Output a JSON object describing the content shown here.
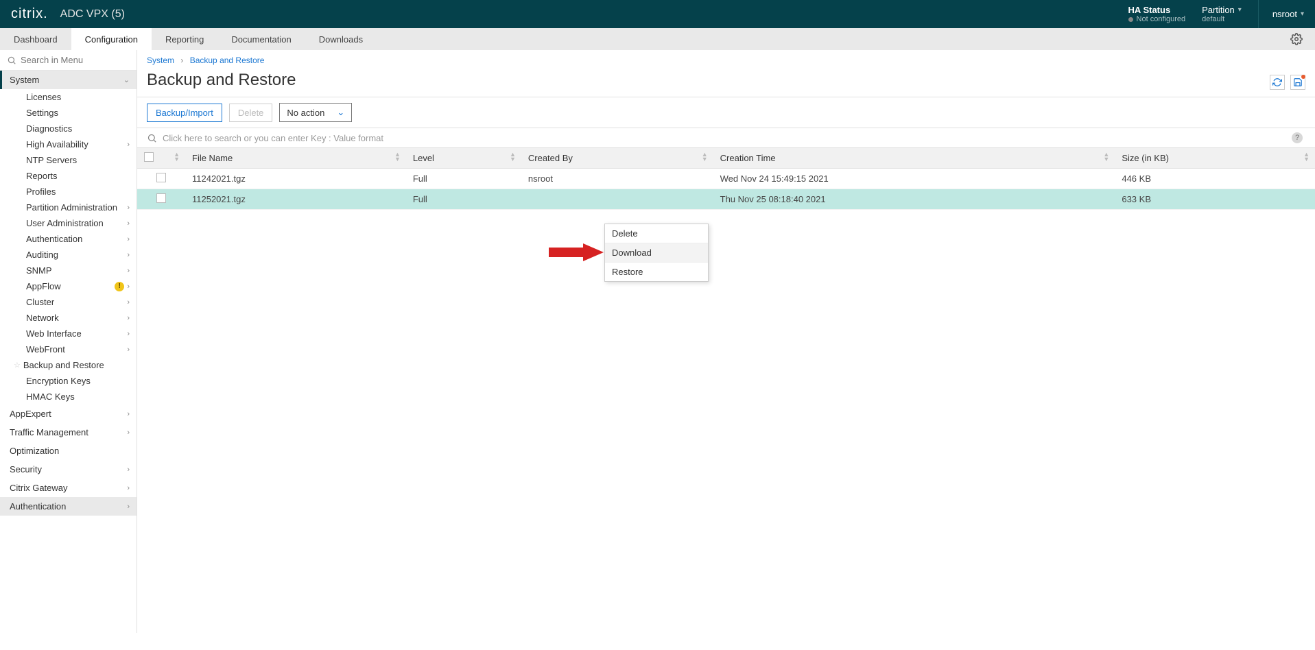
{
  "header": {
    "logo_text": "citrix.",
    "product": "ADC VPX (5)",
    "ha_status_label": "HA Status",
    "ha_status_value": "Not configured",
    "partition_label": "Partition",
    "partition_value": "default",
    "user": "nsroot"
  },
  "tabs": {
    "dashboard": "Dashboard",
    "configuration": "Configuration",
    "reporting": "Reporting",
    "documentation": "Documentation",
    "downloads": "Downloads"
  },
  "sidebar": {
    "search_placeholder": "Search in Menu",
    "system": "System",
    "items": [
      {
        "label": "Licenses",
        "arrow": false
      },
      {
        "label": "Settings",
        "arrow": false
      },
      {
        "label": "Diagnostics",
        "arrow": false
      },
      {
        "label": "High Availability",
        "arrow": true
      },
      {
        "label": "NTP Servers",
        "arrow": false
      },
      {
        "label": "Reports",
        "arrow": false
      },
      {
        "label": "Profiles",
        "arrow": false
      },
      {
        "label": "Partition Administration",
        "arrow": true
      },
      {
        "label": "User Administration",
        "arrow": true
      },
      {
        "label": "Authentication",
        "arrow": true
      },
      {
        "label": "Auditing",
        "arrow": true
      },
      {
        "label": "SNMP",
        "arrow": true
      },
      {
        "label": "AppFlow",
        "arrow": true,
        "alert": true
      },
      {
        "label": "Cluster",
        "arrow": true
      },
      {
        "label": "Network",
        "arrow": true
      },
      {
        "label": "Web Interface",
        "arrow": true
      },
      {
        "label": "WebFront",
        "arrow": true
      },
      {
        "label": "Backup and Restore",
        "arrow": false,
        "star": true
      },
      {
        "label": "Encryption Keys",
        "arrow": false
      },
      {
        "label": "HMAC Keys",
        "arrow": false
      }
    ],
    "l1": [
      {
        "label": "AppExpert",
        "arrow": true
      },
      {
        "label": "Traffic Management",
        "arrow": true
      },
      {
        "label": "Optimization",
        "arrow": false
      },
      {
        "label": "Security",
        "arrow": true
      },
      {
        "label": "Citrix Gateway",
        "arrow": true
      },
      {
        "label": "Authentication",
        "arrow": true,
        "hl": true
      }
    ]
  },
  "breadcrumb": {
    "root": "System",
    "current": "Backup and Restore"
  },
  "page": {
    "title": "Backup and Restore",
    "btn_backup": "Backup/Import",
    "btn_delete": "Delete",
    "btn_noaction": "No action",
    "search_placeholder": "Click here to search or you can enter Key : Value format"
  },
  "table": {
    "headers": {
      "file": "File Name",
      "level": "Level",
      "createdby": "Created By",
      "time": "Creation Time",
      "size": "Size (in KB)"
    },
    "rows": [
      {
        "file": "11242021.tgz",
        "level": "Full",
        "by": "nsroot",
        "time": "Wed Nov 24 15:49:15 2021",
        "size": "446 KB"
      },
      {
        "file": "11252021.tgz",
        "level": "Full",
        "by": "",
        "time": "Thu Nov 25 08:18:40 2021",
        "size": "633 KB"
      }
    ]
  },
  "context_menu": {
    "delete": "Delete",
    "download": "Download",
    "restore": "Restore"
  }
}
